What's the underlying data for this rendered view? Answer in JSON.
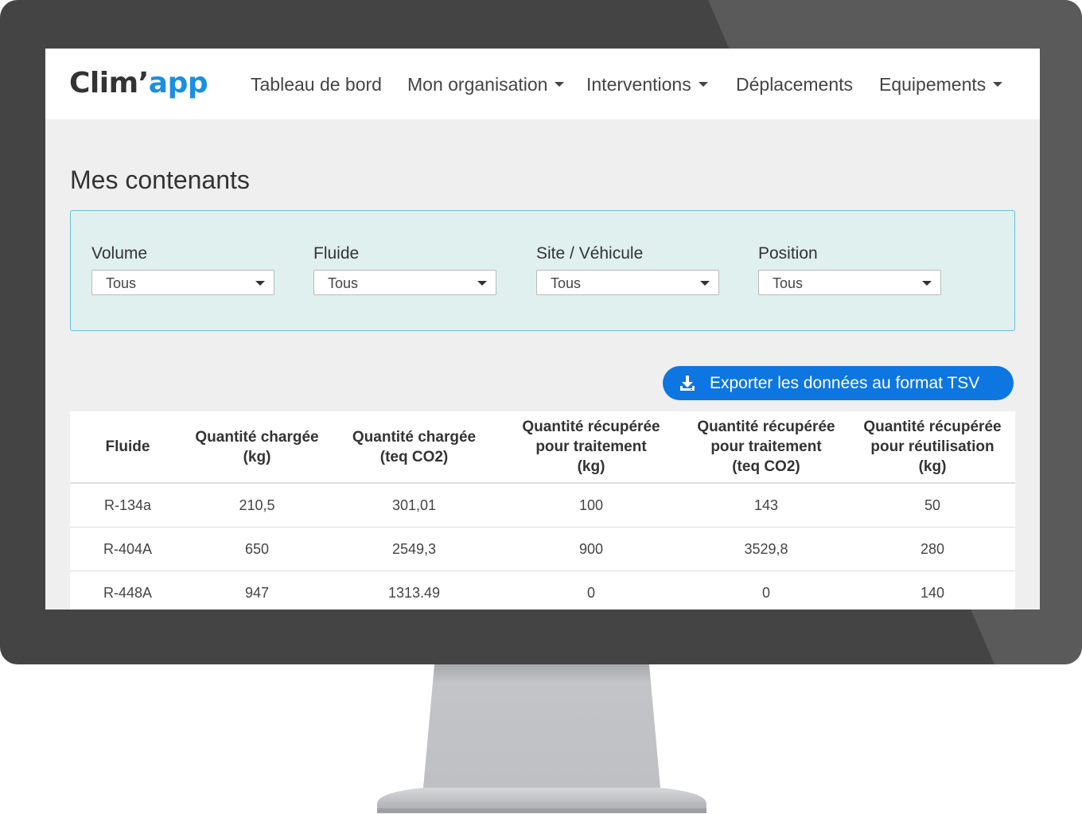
{
  "app": {
    "logo_part1": "Clim’",
    "logo_part2": "app",
    "brand_color": "#1a8fe0"
  },
  "nav": {
    "items": [
      {
        "label": "Tableau de bord",
        "dropdown": false
      },
      {
        "label": "Mon organisation",
        "dropdown": true
      },
      {
        "label": "Interventions",
        "dropdown": true
      },
      {
        "label": "Déplacements",
        "dropdown": false
      },
      {
        "label": "Equipements",
        "dropdown": true
      }
    ]
  },
  "page": {
    "title": "Mes contenants"
  },
  "filters": [
    {
      "label": "Volume",
      "value": "Tous"
    },
    {
      "label": "Fluide",
      "value": "Tous"
    },
    {
      "label": "Site / Véhicule",
      "value": "Tous"
    },
    {
      "label": "Position",
      "value": "Tous"
    }
  ],
  "export": {
    "label": "Exporter les données au format TSV",
    "icon": "download-icon",
    "color": "#0d76e0"
  },
  "table": {
    "headers": [
      "Fluide",
      "Quantité chargée\n(kg)",
      "Quantité chargée\n(teq CO2)",
      "Quantité récupérée\npour traitement\n(kg)",
      "Quantité récupérée\npour traitement\n(teq CO2)",
      "Quantité récupérée\npour réutilisation\n(kg)"
    ],
    "rows": [
      [
        "R-134a",
        "210,5",
        "301,01",
        "100",
        "143",
        "50"
      ],
      [
        "R-404A",
        "650",
        "2549,3",
        "900",
        "3529,8",
        "280"
      ],
      [
        "R-448A",
        "947",
        "1313.49",
        "0",
        "0",
        "140"
      ]
    ]
  }
}
